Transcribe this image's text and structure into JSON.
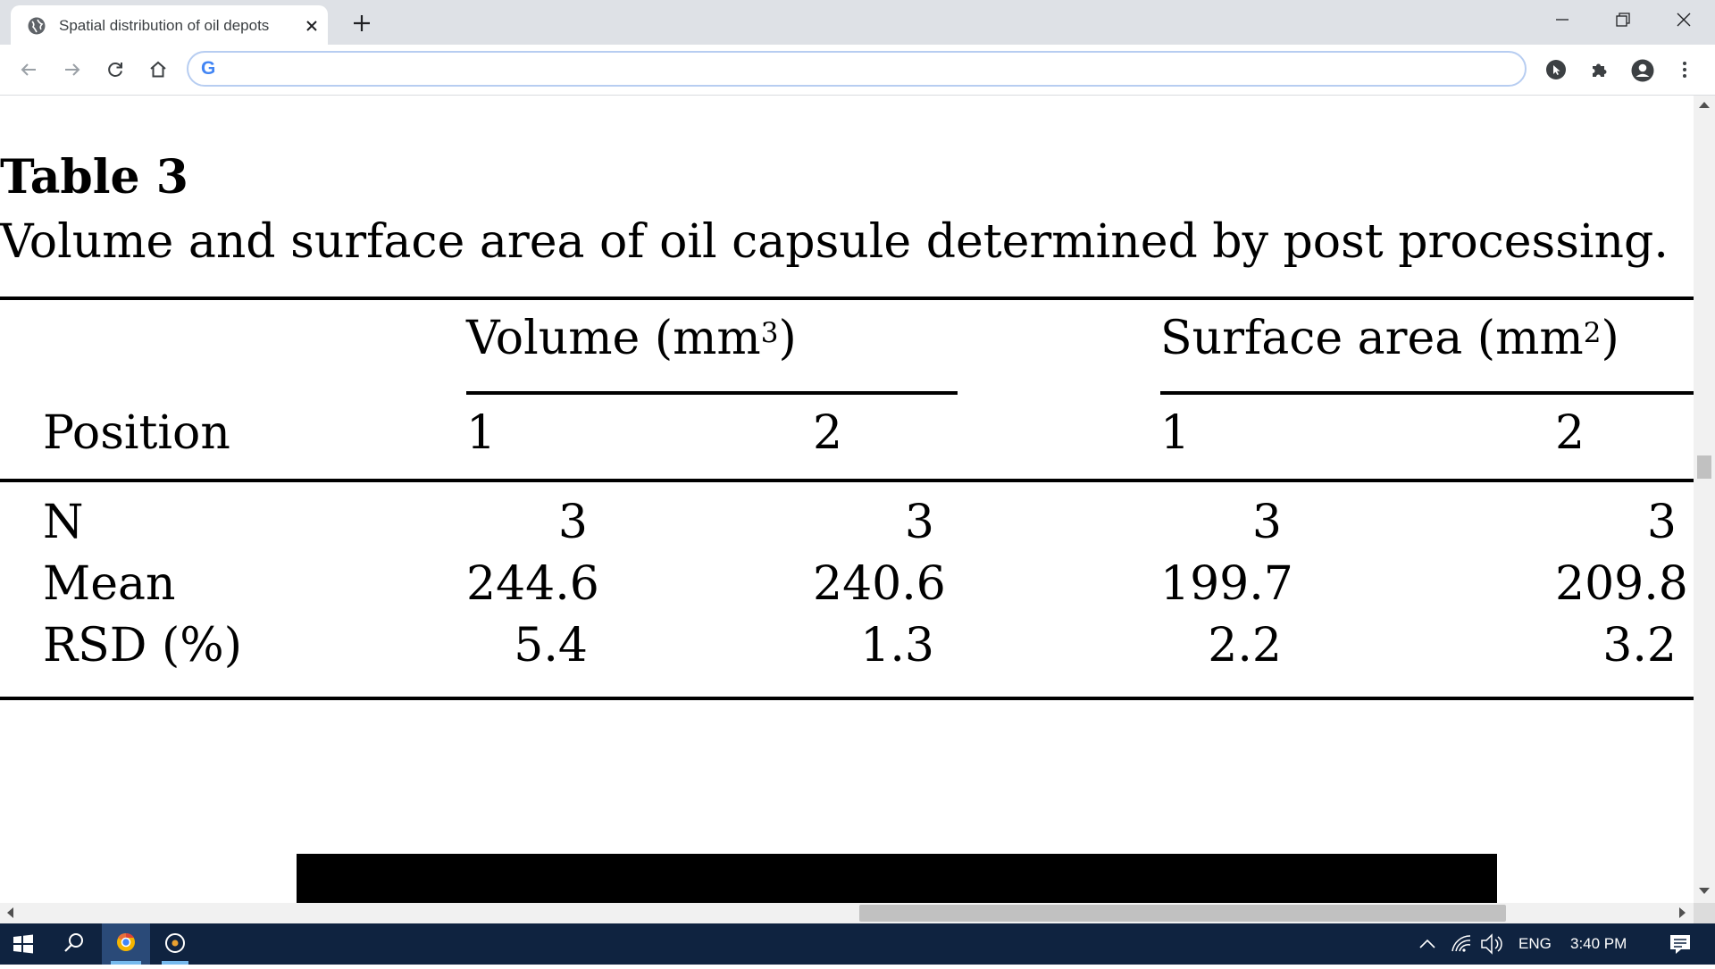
{
  "browser": {
    "tab_title": "Spatial distribution of oil depots",
    "address_value": "",
    "omnibox_logo": "G"
  },
  "page": {
    "table_number": "Table 3",
    "caption": "Volume and surface area of oil capsule determined by post processing.",
    "header": {
      "volume_label": "Volume (mm",
      "volume_exp": "3",
      "volume_close": ")",
      "surface_label": "Surface area (mm",
      "surface_exp": "2",
      "surface_close": ")",
      "position_label": "Position",
      "col_v1": "1",
      "col_v2": "2",
      "col_s1": "1",
      "col_s2": "2"
    },
    "rows": [
      {
        "label": "N",
        "v1": "3",
        "v2": "3",
        "s1": "3",
        "s2": "3"
      },
      {
        "label": "Mean",
        "v1": "244.6",
        "v2": "240.6",
        "s1": "199.7",
        "s2": "209.8"
      },
      {
        "label": "RSD (%)",
        "v1": "5.4",
        "v2": "1.3",
        "s1": "2.2",
        "s2": "3.2"
      }
    ]
  },
  "taskbar": {
    "language": "ENG",
    "time": "3:40 PM"
  },
  "colors": {
    "tabstrip": "#dee1e6",
    "omnibox_border": "#b7cdf1",
    "taskbar": "#0f2340",
    "taskbar_active": "#2a4a78"
  },
  "icons": [
    "globe-icon",
    "close-icon",
    "plus-icon",
    "minimize-icon",
    "restore-icon",
    "back-icon",
    "forward-icon",
    "reload-icon",
    "home-icon",
    "google-logo",
    "cursor-extension-icon",
    "puzzle-extension-icon",
    "profile-icon",
    "menu-icon",
    "windows-start-icon",
    "search-icon",
    "chrome-app-icon",
    "media-app-icon",
    "chevron-up-icon",
    "network-icon",
    "volume-icon",
    "notification-icon"
  ]
}
